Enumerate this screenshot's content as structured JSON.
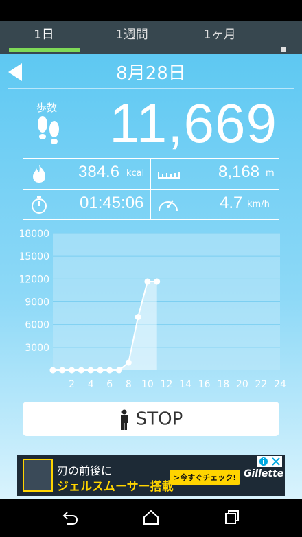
{
  "tabs": [
    {
      "label": "1日"
    },
    {
      "label": "1週間"
    },
    {
      "label": "1ヶ月"
    }
  ],
  "date": "8月28日",
  "steps": {
    "label": "歩数",
    "value": "11,669"
  },
  "stats": {
    "calories": {
      "value": "384.6",
      "unit": "kcal"
    },
    "distance": {
      "value": "8,168",
      "unit": "m"
    },
    "time": {
      "value": "01:45:06"
    },
    "speed": {
      "value": "4.7",
      "unit": "km/h"
    }
  },
  "stop_button": {
    "label": "STOP"
  },
  "ad": {
    "line1": "刃の前後に",
    "line2": "ジェルスムーサー搭載",
    "cta": ">今すぐチェック!",
    "brand": "Gillette"
  },
  "colors": {
    "accent": "#7ed957",
    "background_top": "#5ec8f2"
  },
  "chart_data": {
    "type": "line",
    "x": [
      0,
      1,
      2,
      3,
      4,
      5,
      6,
      7,
      8,
      9,
      10,
      11
    ],
    "values": [
      0,
      0,
      0,
      0,
      0,
      0,
      0,
      0,
      1000,
      7000,
      11669,
      11669
    ],
    "xticks": [
      "2",
      "4",
      "6",
      "8",
      "10",
      "12",
      "14",
      "16",
      "18",
      "20",
      "22",
      "24"
    ],
    "yticks": [
      "3000",
      "6000",
      "9000",
      "12000",
      "15000",
      "18000"
    ],
    "xlim": [
      0,
      24
    ],
    "ylim": [
      0,
      18000
    ]
  }
}
